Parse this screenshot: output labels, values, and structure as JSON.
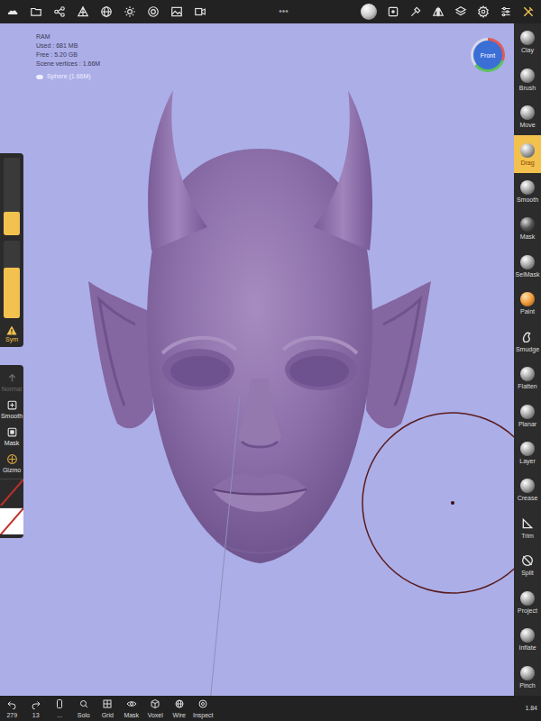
{
  "top_bar": {
    "menu": "•••"
  },
  "info": {
    "lines": [
      "RAM",
      "Used : 681 MB",
      "Free : 5.20 GB",
      "Scene vertices : 1.66M"
    ],
    "object": {
      "label": "Sphere (1.66M)",
      "visible": true
    }
  },
  "view_gizmo": {
    "label": "Front"
  },
  "left_sliders": [
    {
      "level": 0.3
    },
    {
      "level": 0.65
    }
  ],
  "symmetry": {
    "label": "Sym",
    "on": true
  },
  "left_tools": [
    {
      "label": "Normal",
      "disabled": true
    },
    {
      "label": "Smooth",
      "disabled": false
    },
    {
      "label": "Mask",
      "disabled": false
    },
    {
      "label": "Gizmo",
      "disabled": false
    }
  ],
  "colors": [
    {
      "color": "#2b2b2b"
    },
    {
      "color": "#ffffff"
    }
  ],
  "tools": [
    {
      "label": "Clay",
      "selected": false
    },
    {
      "label": "Brush",
      "selected": false
    },
    {
      "label": "Move",
      "selected": false
    },
    {
      "label": "Drag",
      "selected": true
    },
    {
      "label": "Smooth",
      "selected": false
    },
    {
      "label": "Mask",
      "selected": false
    },
    {
      "label": "SelMask",
      "selected": false
    },
    {
      "label": "Paint",
      "selected": false
    },
    {
      "label": "Smudge",
      "selected": false
    },
    {
      "label": "Flatten",
      "selected": false
    },
    {
      "label": "Planar",
      "selected": false
    },
    {
      "label": "Layer",
      "selected": false
    },
    {
      "label": "Crease",
      "selected": false
    },
    {
      "label": "Trim",
      "selected": false
    },
    {
      "label": "Split",
      "selected": false
    },
    {
      "label": "Project",
      "selected": false
    },
    {
      "label": "Inflate",
      "selected": false
    },
    {
      "label": "Pinch",
      "selected": false
    }
  ],
  "bottom_bar": {
    "items": [
      {
        "label": "279"
      },
      {
        "label": "13"
      },
      {
        "label": "..."
      },
      {
        "label": "Solo"
      },
      {
        "label": "Grid"
      },
      {
        "label": "Mask"
      },
      {
        "label": "Voxel"
      },
      {
        "label": "Wire"
      },
      {
        "label": "Inspect"
      }
    ],
    "zoom": "1.84"
  }
}
